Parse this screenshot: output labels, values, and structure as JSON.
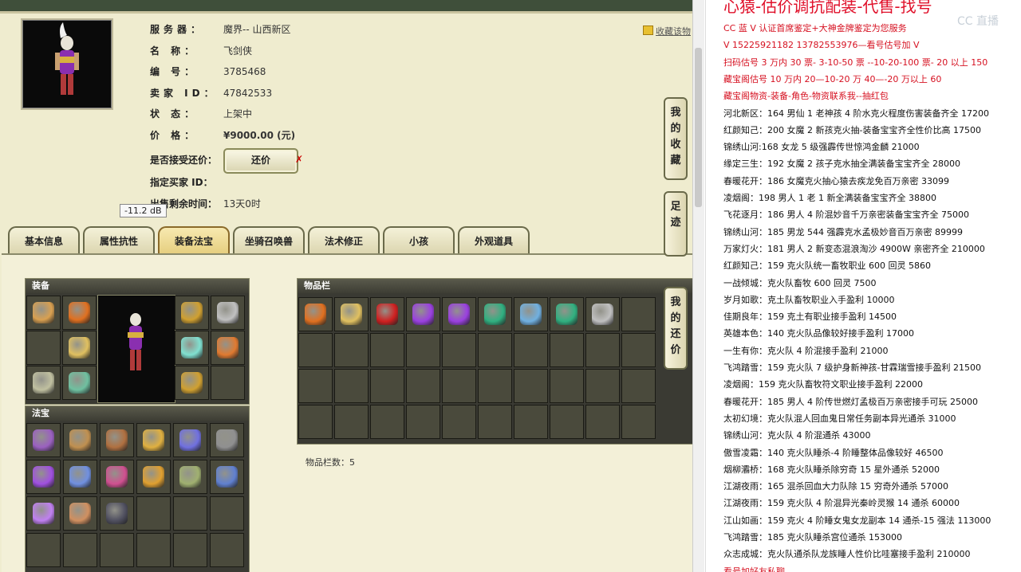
{
  "seller": {
    "server_label": "服务器：",
    "server": "魔界-- 山西新区",
    "name_label": "名 称：",
    "name": "飞剑侠",
    "id_label": "编 号：",
    "id": "3785468",
    "seller_id_label": "卖家 ID：",
    "seller_id": "47842533",
    "status_label": "状 态：",
    "status": "上架中",
    "price_label": "价 格：",
    "price": "¥9000.00 (元)",
    "bargain_label": "是否接受还价：",
    "bargain_button": "还价",
    "bargain_mark": "✗",
    "buyer_label": "指定买家 ID：",
    "remain_label": "出售剩余时间：",
    "remain": "13天0时",
    "favorite": "收藏该物"
  },
  "tooltip": "-11.2 dB",
  "tabs": [
    "基本信息",
    "属性抗性",
    "装备法宝",
    "坐骑召唤兽",
    "法术修正",
    "小孩",
    "外观道具"
  ],
  "active_tab": "装备法宝",
  "panels": {
    "equip_title": "装备",
    "treasure_title": "法宝",
    "inventory_title": "物品栏",
    "inventory_count": "物品栏数：5"
  },
  "side_tabs": [
    "我的收藏",
    "足迹",
    "我的还价"
  ],
  "equip_icons": [
    "hat-icon",
    "crown-icon",
    "armor-icon",
    "necklace-icon",
    "weapon-icon",
    "ring-icon",
    "shoes-icon",
    "wing-icon",
    "ornament-icon"
  ],
  "treasure_icons": [
    "treasure-1-icon",
    "treasure-2-icon",
    "treasure-3-icon",
    "treasure-4-icon",
    "treasure-5-icon",
    "treasure-6-icon",
    "treasure-7-icon",
    "treasure-8-icon",
    "treasure-9-icon",
    "treasure-10-icon",
    "treasure-11-icon",
    "treasure-12-icon",
    "treasure-13-icon",
    "treasure-14-icon",
    "treasure-15-icon"
  ],
  "inventory_icons": [
    "crown-icon",
    "armor-icon",
    "red-gem-icon",
    "purple-gem-icon",
    "purple-gem-icon",
    "green-gem-icon",
    "blue-gem-icon",
    "green-gem-icon",
    "portrait-icon"
  ],
  "right_panel": {
    "title": "心猿-估价调抗配装-代售-找号",
    "watermark": "CC 直播",
    "lines": [
      {
        "text": "CC 蓝 V 认证首席鉴定+大神金牌鉴定为您服务",
        "color": "red"
      },
      {
        "text": "V 15225921182    13782553976—看号估号加 V",
        "color": "red"
      },
      {
        "text": "扫码估号 3 万内 30 票- 3-10-50 票  --10-20-100 票- 20 以上 150",
        "color": "red"
      },
      {
        "text": "藏宝阁估号 10 万内 20—10-20 万 40—-20 万以上 60",
        "color": "red"
      },
      {
        "text": "藏宝阁物资-装备-角色-物资联系我--抽红包",
        "color": "red"
      },
      {
        "text": "河北新区：164 男仙 1 老神孩 4 阶水克火程度伤害装备齐全 17200",
        "color": "black"
      },
      {
        "text": "红颜知己：200 女魔 2 新孩克火抽-装备宝宝齐全性价比高 17500",
        "color": "black"
      },
      {
        "text": "锦绣山河:168 女龙 5 级强霹传世惊鸿金麟 21000",
        "color": "black"
      },
      {
        "text": "缘定三生：192 女魔 2 孩子克水抽全满装备宝宝齐全 28000",
        "color": "black"
      },
      {
        "text": "春暖花开：186 女魔克火抽心猿去疾龙免百万亲密 33099",
        "color": "black"
      },
      {
        "text": "凌烟阁：198 男人 1 老 1 新全满装备宝宝齐全 38800",
        "color": "black"
      },
      {
        "text": "飞花逐月：186 男人 4 阶混妙音千万亲密装备宝宝齐全 75000",
        "color": "black"
      },
      {
        "text": "锦绣山河：185 男龙 544 强霹克水孟极妙音百万亲密 89999",
        "color": "black"
      },
      {
        "text": "万家灯火：181 男人 2 新变态混浪淘沙 4900W 亲密齐全 210000",
        "color": "black"
      },
      {
        "text": "红颜知己：159 克火队统一畜牧职业 600 回灵 5860",
        "color": "black"
      },
      {
        "text": "一战倾城：克火队畜牧 600 回灵 7500",
        "color": "black"
      },
      {
        "text": "岁月如歌：克土队畜牧职业入手盈利 10000",
        "color": "black"
      },
      {
        "text": "佳期良年：159 克土有职业接手盈利 14500",
        "color": "black"
      },
      {
        "text": "英雄本色：140 克火队品像较好接手盈利 17000",
        "color": "black"
      },
      {
        "text": "一生有你：克火队 4 阶混接手盈利 21000",
        "color": "black"
      },
      {
        "text": "飞鸿踏雪：159 克火队 7 级护身新神孩-甘霖瑞雪接手盈利 21500",
        "color": "black"
      },
      {
        "text": "凌烟阁：159 克火队畜牧符文职业接手盈利 22000",
        "color": "black"
      },
      {
        "text": "春暖花开：185 男人 4 阶传世燃灯孟极百万亲密接手可玩 25000",
        "color": "black"
      },
      {
        "text": "太初幻境：克火队混人回血鬼日常任务副本异光通杀 31000",
        "color": "black"
      },
      {
        "text": "锦绣山河：克火队 4 阶混通杀 43000",
        "color": "black"
      },
      {
        "text": "傲雪凌霜：140 克火队睡杀-4 阶睡整体品像较好 46500",
        "color": "black"
      },
      {
        "text": "烟柳灞桥：168 克火队睡杀除穷奇 15 星外通杀 52000",
        "color": "black"
      },
      {
        "text": "江湖夜雨：165 混杀回血大力队除 15 穷奇外通杀 57000",
        "color": "black"
      },
      {
        "text": "江湖夜雨：159 克火队 4 阶混异光秦岭灵猴 14 通杀 60000",
        "color": "black"
      },
      {
        "text": "江山如画：159 克火 4 阶睡女鬼女龙副本 14 通杀-15 强法 113000",
        "color": "black"
      },
      {
        "text": "飞鸿踏雪：185 克火队睡杀宫位通杀 153000",
        "color": "black"
      },
      {
        "text": "众志成城：克火队通杀队龙族睡人性价比哇塞接手盈利 210000",
        "color": "black"
      },
      {
        "text": "看号加好友私聊",
        "color": "red"
      }
    ]
  },
  "colors": {
    "price": "#cc0000",
    "red_text": "#d61020",
    "panel_bg": "#3a3a33",
    "page_bg": "#efeccf"
  }
}
